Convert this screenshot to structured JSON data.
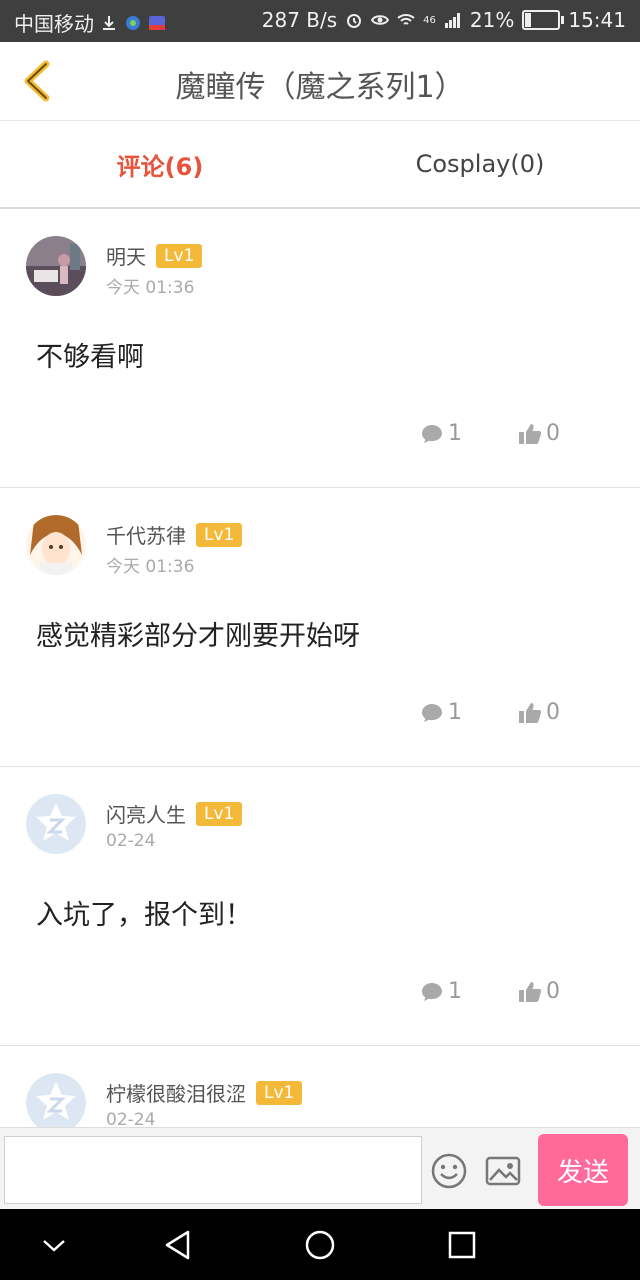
{
  "status": {
    "carrier": "中国移动",
    "speed": "287 B/s",
    "network": "46",
    "battery": "21%",
    "battery_level": 0.21,
    "time": "15:41"
  },
  "header": {
    "title": "魔瞳传（魔之系列1）",
    "back_icon": "chevron-left-icon",
    "accent": "#f3bd32"
  },
  "tabs": [
    {
      "label": "评论(6)",
      "active": true
    },
    {
      "label": "Cosplay(0)",
      "active": false
    }
  ],
  "comments": [
    {
      "user": "明天",
      "level": "Lv1",
      "time": "今天 01:36",
      "text": "不够看啊",
      "replies": "1",
      "likes": "0"
    },
    {
      "user": "千代苏律",
      "level": "Lv1",
      "time": "今天 01:36",
      "text": "感觉精彩部分才刚要开始呀",
      "replies": "1",
      "likes": "0"
    },
    {
      "user": "闪亮人生",
      "level": "Lv1",
      "time": "02-24",
      "text": "入坑了，报个到！",
      "replies": "1",
      "likes": "0"
    },
    {
      "user": "柠檬很酸泪很涩",
      "level": "Lv1",
      "time": "02-24",
      "text": "",
      "replies": "",
      "likes": ""
    }
  ],
  "composer": {
    "placeholder": "",
    "send_label": "发送",
    "send_color": "#ff6a9b"
  },
  "colors": {
    "active_tab": "#e5543b",
    "level_badge": "#f5b93a"
  }
}
